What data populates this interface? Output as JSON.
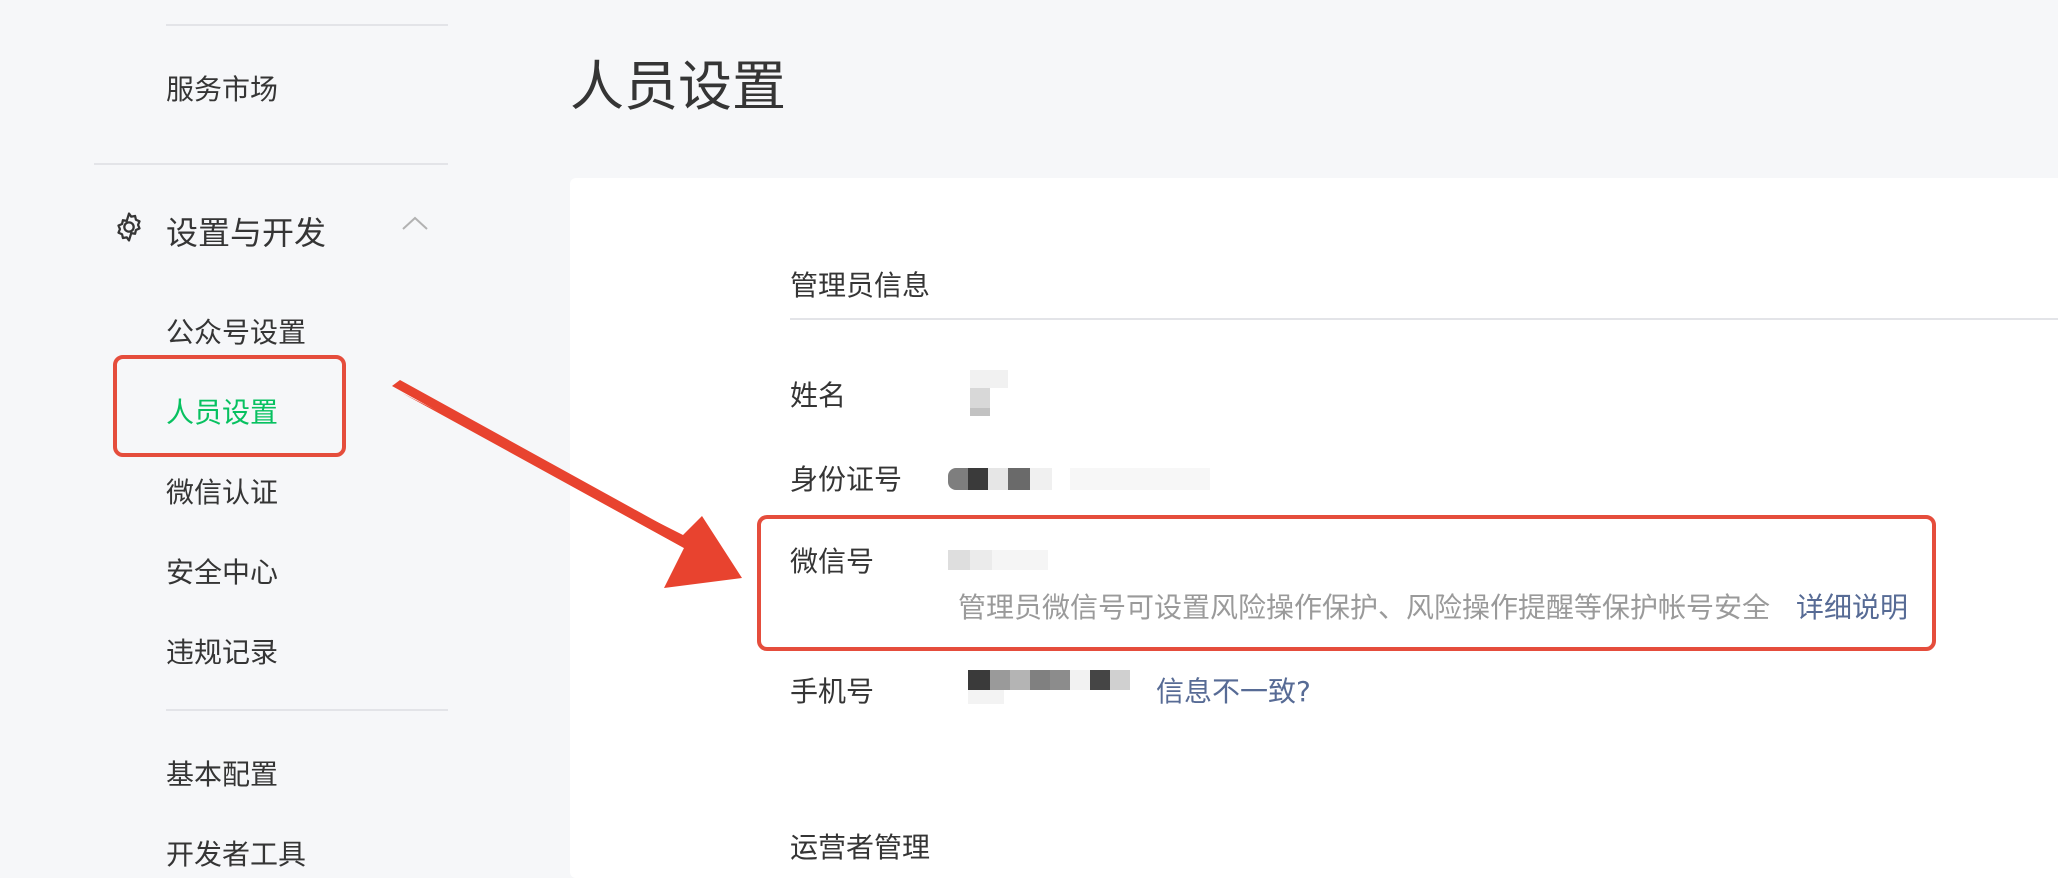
{
  "sidebar": {
    "service_market": "服务市场",
    "settings_group": {
      "label": "设置与开发",
      "icon": "gear-icon",
      "collapse_icon": "chevron-up-icon"
    },
    "items": [
      {
        "label": "公众号设置"
      },
      {
        "label": "人员设置",
        "active": true
      },
      {
        "label": "微信认证"
      },
      {
        "label": "安全中心"
      },
      {
        "label": "违规记录"
      }
    ],
    "base_config": "基本配置",
    "dev_tools": "开发者工具"
  },
  "page_title": "人员设置",
  "admin_section": {
    "title": "管理员信息",
    "fields": {
      "name_label": "姓名",
      "id_label": "身份证号",
      "wechat_label": "微信号",
      "wechat_tip": "管理员微信号可设置风险操作保护、风险操作提醒等保护帐号安全",
      "wechat_link": "详细说明",
      "phone_label": "手机号",
      "phone_link": "信息不一致?"
    }
  },
  "operator_section": {
    "title": "运营者管理"
  },
  "colors": {
    "accent": "#07c160",
    "link": "#576b95",
    "annotation": "#e54d3c"
  }
}
